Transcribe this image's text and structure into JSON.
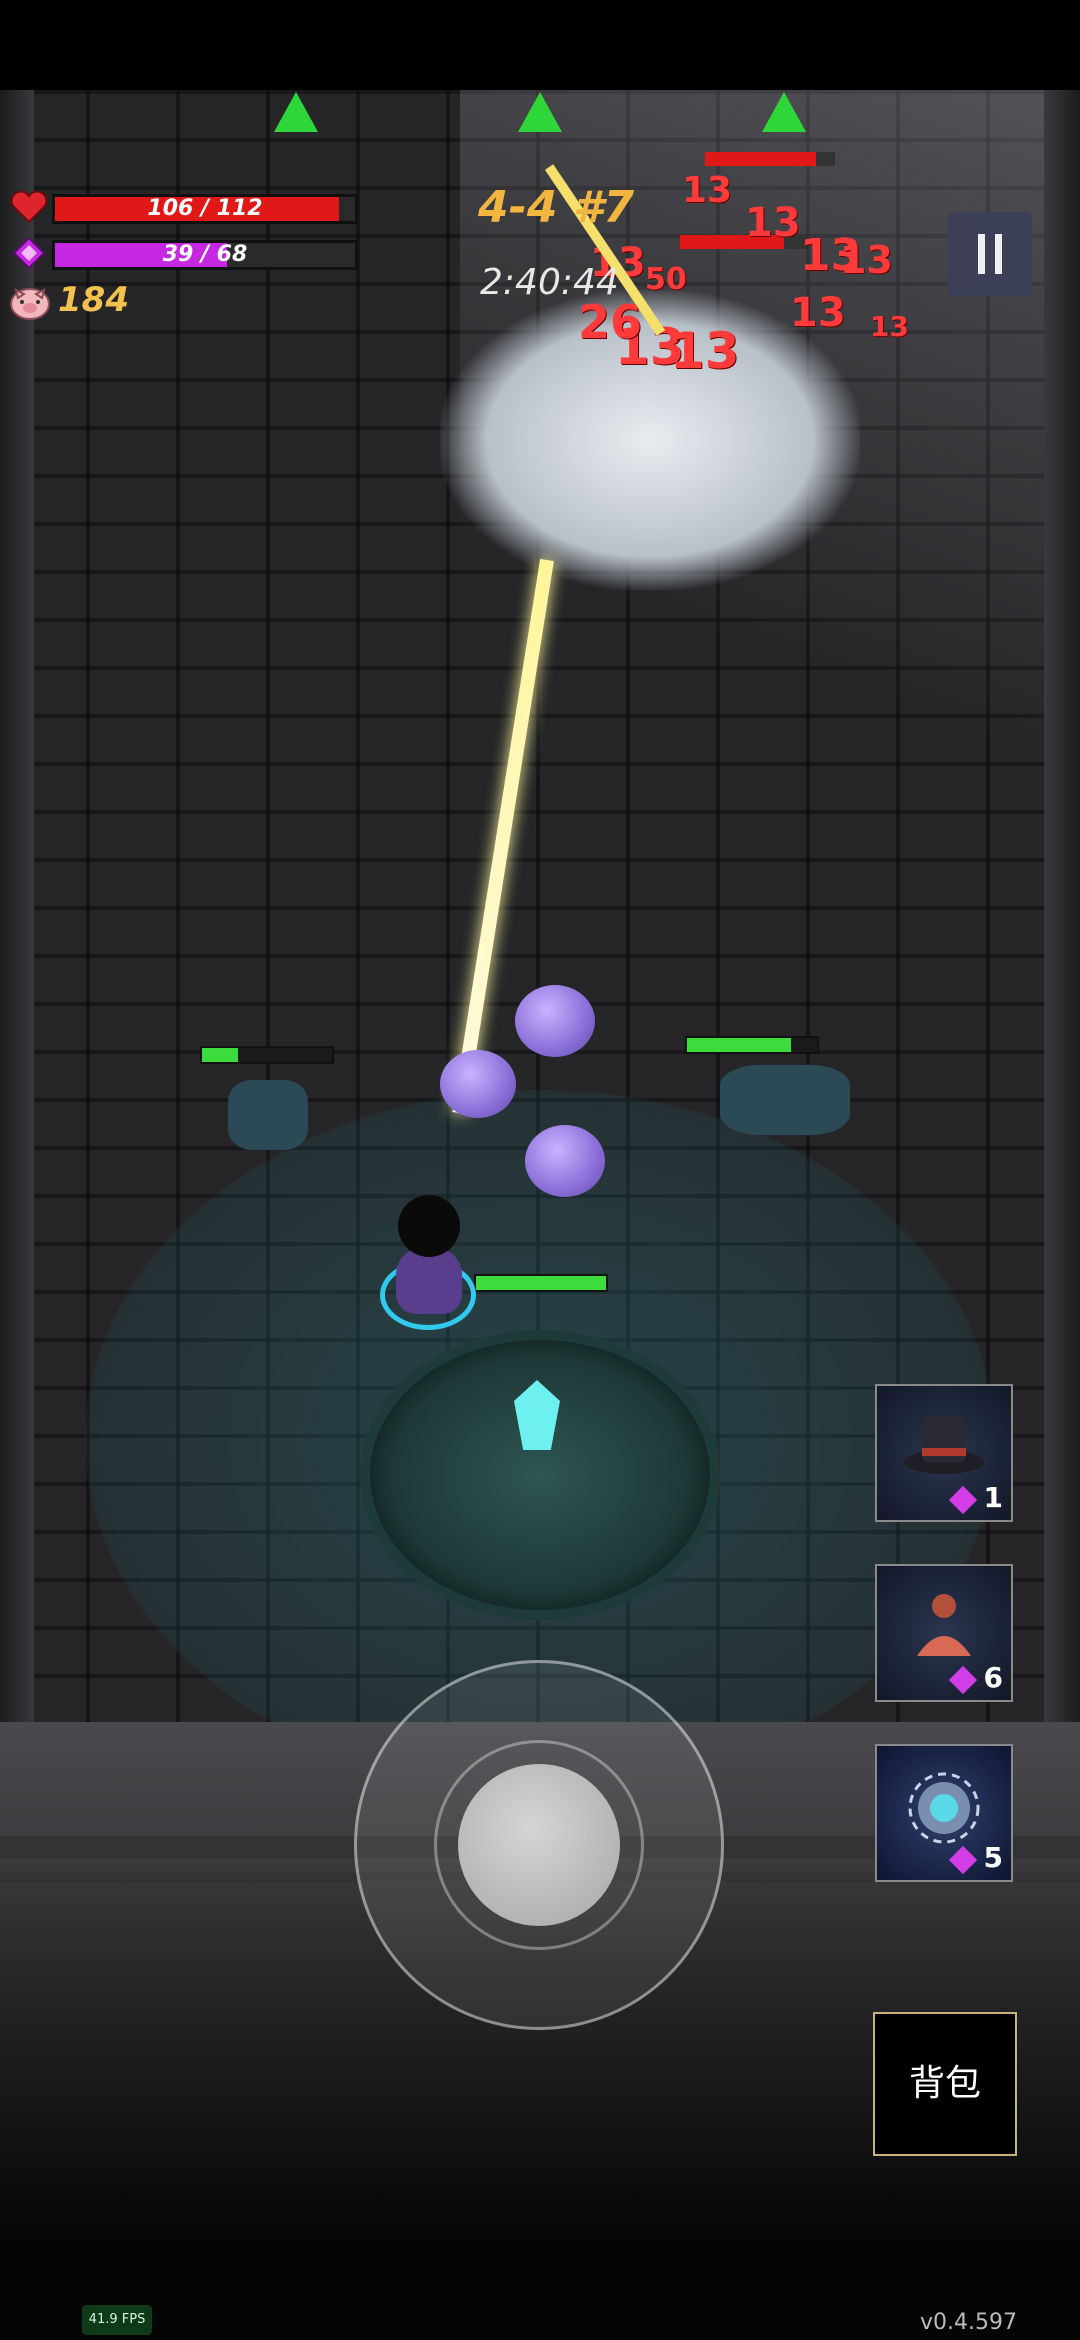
{
  "hud": {
    "hp_text": "106 / 112",
    "hp_fraction": 0.946,
    "mana_text": "39 / 68",
    "mana_fraction": 0.574,
    "coins": "184",
    "stage": "4-4 #7",
    "timer": "2:40:44"
  },
  "combat": {
    "damage_numbers": [
      "13",
      "13",
      "13",
      "13",
      "13",
      "13",
      "13",
      "13",
      "13",
      "50",
      "26"
    ]
  },
  "skills": [
    {
      "icon": "top-hat-icon",
      "cost": "1"
    },
    {
      "icon": "cloak-bust-icon",
      "cost": "6"
    },
    {
      "icon": "orb-icon",
      "cost": "5"
    }
  ],
  "buttons": {
    "bag_label": "背包"
  },
  "footer": {
    "fps": "41.9 FPS",
    "version": "v0.4.597"
  },
  "colors": {
    "hp": "#e01818",
    "mana": "#c528e0",
    "coin_text": "#f2c14e",
    "stage_text": "#f2b640",
    "indicator": "#2fd63a"
  }
}
